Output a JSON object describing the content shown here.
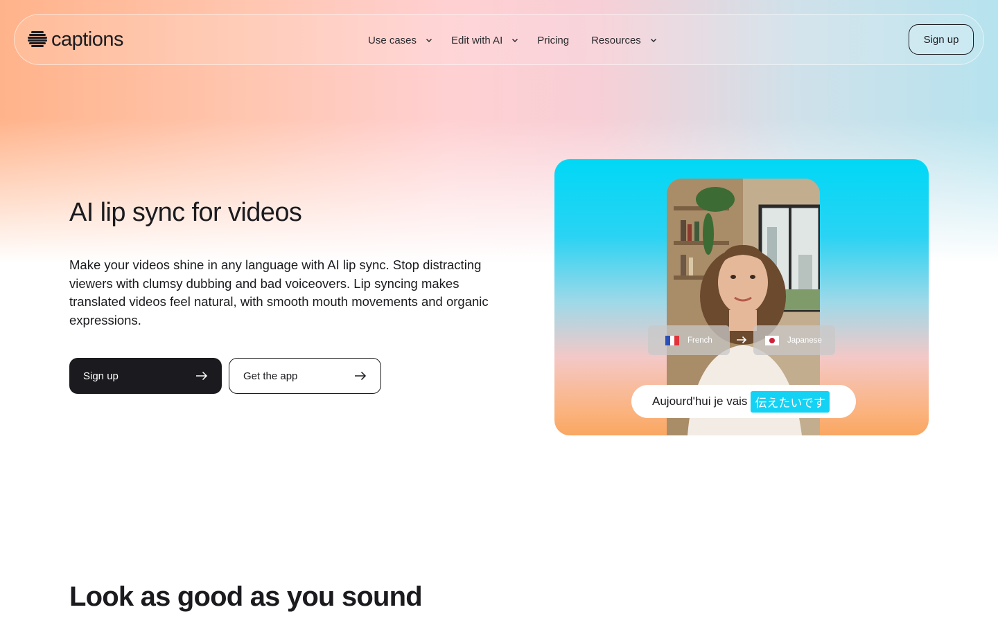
{
  "brand": {
    "name": "captions"
  },
  "nav": {
    "items": [
      {
        "label": "Use cases",
        "has_dropdown": true
      },
      {
        "label": "Edit with AI",
        "has_dropdown": true
      },
      {
        "label": "Pricing",
        "has_dropdown": false
      },
      {
        "label": "Resources",
        "has_dropdown": true
      }
    ],
    "signup_label": "Sign up"
  },
  "hero": {
    "title": "AI lip sync for videos",
    "description": "Make your videos shine in any language with AI lip sync. Stop distracting viewers with clumsy dubbing and bad voiceovers. Lip syncing makes translated videos feel natural, with smooth mouth movements and organic expressions.",
    "primary_cta": "Sign up",
    "secondary_cta": "Get the app"
  },
  "media": {
    "source_language": "French",
    "target_language": "Japanese",
    "caption_text": "Aujourd'hui je vais",
    "caption_highlight": "伝えたいです"
  },
  "section": {
    "title": "Look as good as you sound"
  },
  "colors": {
    "primary": "#1b1b1f",
    "accent_cyan": "#14d2f4",
    "gradient_orange": "#ffb38a",
    "gradient_pink": "#ffd0d2",
    "gradient_blue": "#b6e3ee"
  },
  "icons": [
    "captions-logo-icon",
    "chevron-down-icon",
    "arrow-right-icon",
    "france-flag-icon",
    "japan-flag-icon"
  ]
}
